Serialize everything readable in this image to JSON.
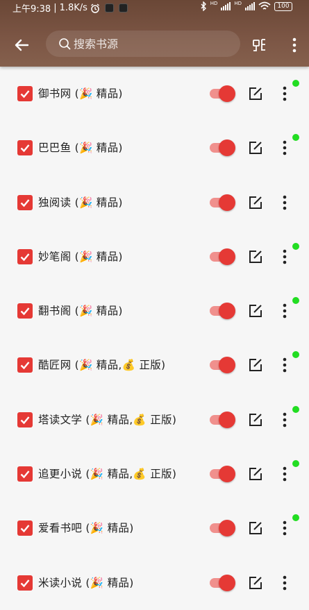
{
  "status_bar": {
    "time": "上午9:38",
    "speed": "1.8K/s",
    "battery": "100",
    "signal_label_1": "HD",
    "signal_label_2": "HD"
  },
  "toolbar": {
    "search_placeholder": "搜索书源"
  },
  "colors": {
    "header": "#7b5544",
    "accent": "#e53935",
    "switch_track": "#f0908d",
    "online_dot": "#22dd22",
    "background": "#f6f6f6"
  },
  "sources": [
    {
      "name": "御书网 (🎉 精品)",
      "checked": true,
      "enabled": true,
      "dot": true
    },
    {
      "name": "巴巴鱼 (🎉 精品)",
      "checked": true,
      "enabled": true,
      "dot": true
    },
    {
      "name": "独阅读 (🎉 精品)",
      "checked": true,
      "enabled": true,
      "dot": false
    },
    {
      "name": "妙笔阁 (🎉 精品)",
      "checked": true,
      "enabled": true,
      "dot": true
    },
    {
      "name": "翻书阁 (🎉 精品)",
      "checked": true,
      "enabled": true,
      "dot": true
    },
    {
      "name": "酷匠网 (🎉 精品,💰 正版)",
      "checked": true,
      "enabled": true,
      "dot": true
    },
    {
      "name": "塔读文学 (🎉 精品,💰 正版)",
      "checked": true,
      "enabled": true,
      "dot": true
    },
    {
      "name": "追更小说 (🎉 精品,💰 正版)",
      "checked": true,
      "enabled": true,
      "dot": true
    },
    {
      "name": "爱看书吧 (🎉 精品)",
      "checked": true,
      "enabled": true,
      "dot": true
    },
    {
      "name": "米读小说 (🎉 精品)",
      "checked": true,
      "enabled": true,
      "dot": false
    }
  ]
}
